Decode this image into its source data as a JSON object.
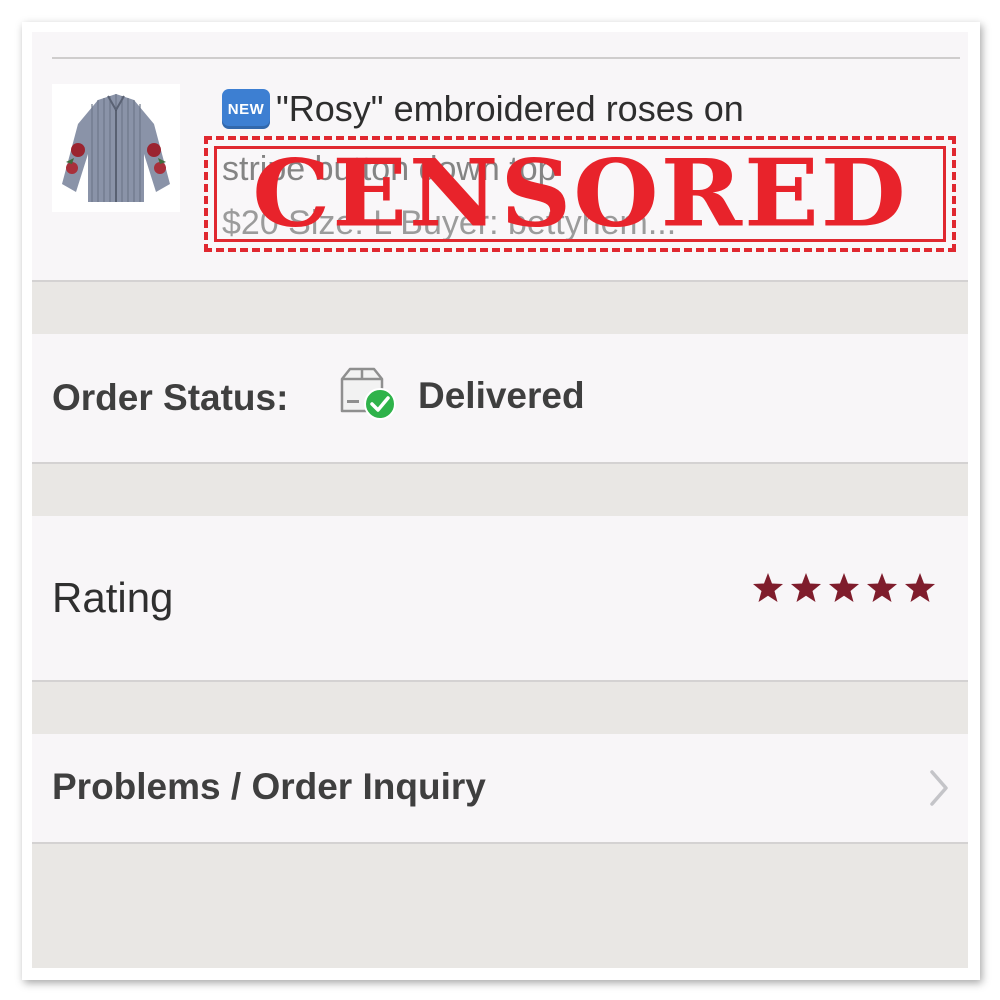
{
  "product": {
    "badge": "NEW",
    "title_line1": "\"Rosy\" embroidered roses on",
    "title_line2": "stripe button down top",
    "meta_line": "$20  Size: L  Buyer: bettyhem..."
  },
  "censor": {
    "text": "CENSORED",
    "color": "#e8232b"
  },
  "order_status": {
    "label": "Order Status:",
    "value": "Delivered",
    "icon": "package-delivered-icon"
  },
  "rating": {
    "label": "Rating",
    "stars": 5,
    "max_stars": 5,
    "star_color": "#7f1d2c"
  },
  "problems": {
    "label": "Problems / Order Inquiry"
  },
  "colors": {
    "background": "#e9e7e4",
    "card": "#f8f6f8",
    "text": "#3f3f3f",
    "check_green": "#2fb34a"
  }
}
